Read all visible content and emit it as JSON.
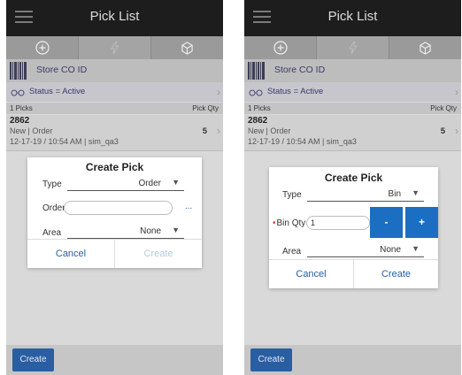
{
  "app": {
    "title": "Pick List",
    "toolbar": {
      "icons": [
        "add-circle-icon",
        "lightning-icon",
        "cube-icon"
      ]
    },
    "scan_field": {
      "label": "Store CO ID",
      "icon": "barcode-icon"
    },
    "filter": {
      "label": "Status = Active",
      "icon": "glasses-icon"
    },
    "list_header": {
      "left": "1 Picks",
      "right": "Pick Qty"
    },
    "list_items": [
      {
        "pick_id": "2862",
        "meta": "New  |  Order",
        "date": "12-17-19 / 10:54 AM  |  sim_qa3",
        "qty": "5"
      }
    ],
    "create_button": "Create"
  },
  "dialog_order": {
    "title": "Create Pick",
    "type_label": "Type",
    "type_value": "Order",
    "order_label": "Order",
    "order_value": "",
    "ellipsis": "...",
    "area_label": "Area",
    "area_value": "None",
    "cancel": "Cancel",
    "create": "Create"
  },
  "dialog_bin": {
    "title": "Create Pick",
    "type_label": "Type",
    "type_value": "Bin",
    "required_mark": "•",
    "bin_qty_label": "Bin Qty",
    "bin_qty_value": "1",
    "minus": "-",
    "plus": "+",
    "area_label": "Area",
    "area_value": "None",
    "cancel": "Cancel",
    "create": "Create"
  },
  "colors": {
    "accent": "#2a5ea3",
    "stepper": "#1b6ec2",
    "appbar": "#1d1d1d",
    "required": "#d83a3a"
  }
}
